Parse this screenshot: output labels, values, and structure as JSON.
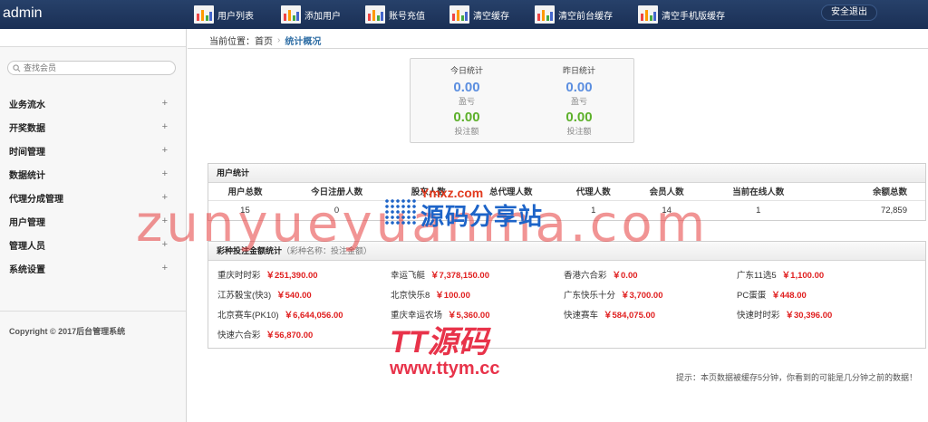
{
  "brand": "admin",
  "nav": [
    {
      "label": "用户列表",
      "icon": "chart-icon"
    },
    {
      "label": "添加用户",
      "icon": "chart-icon"
    },
    {
      "label": "账号充值",
      "icon": "chart-icon"
    },
    {
      "label": "清空缓存",
      "icon": "chart-icon"
    },
    {
      "label": "清空前台缓存",
      "icon": "chart-icon"
    },
    {
      "label": "清空手机版缓存",
      "icon": "chart-icon"
    }
  ],
  "logout_label": "安全退出",
  "sidebar": {
    "search_placeholder": "查找会员",
    "items": [
      {
        "label": "业务流水",
        "toggle": "+"
      },
      {
        "label": "开奖数据",
        "toggle": "+"
      },
      {
        "label": "时间管理",
        "toggle": "+"
      },
      {
        "label": "数据统计",
        "toggle": "+"
      },
      {
        "label": "代理分成管理",
        "toggle": "+"
      },
      {
        "label": "用户管理",
        "toggle": "+"
      },
      {
        "label": "管理人员",
        "toggle": "+"
      },
      {
        "label": "系统设置",
        "toggle": "+"
      }
    ],
    "copyright": "Copyright © 2017后台管理系统"
  },
  "breadcrumb": {
    "prefix": "当前位置：首页",
    "current": "统计概况"
  },
  "stats": {
    "today": {
      "title": "今日统计",
      "profit_value": "0.00",
      "profit_label": "盈亏",
      "bet_value": "0.00",
      "bet_label": "投注额"
    },
    "yesterday": {
      "title": "昨日统计",
      "profit_value": "0.00",
      "profit_label": "盈亏",
      "bet_value": "0.00",
      "bet_label": "投注额"
    }
  },
  "user_stats": {
    "title": "用户统计",
    "headers": [
      "用户总数",
      "今日注册人数",
      "股东人数",
      "总代理人数",
      "代理人数",
      "会员人数",
      "当前在线人数",
      "余额总数"
    ],
    "values": [
      "15",
      "0",
      "",
      "",
      "1",
      "14",
      "1",
      "72,859"
    ]
  },
  "lottery": {
    "title": "彩种投注金额统计",
    "subtitle": "（彩种名称：投注金额）",
    "items": [
      {
        "name": "重庆时时彩",
        "amount": "￥251,390.00"
      },
      {
        "name": "幸运飞艇",
        "amount": "￥7,378,150.00"
      },
      {
        "name": "香港六合彩",
        "amount": "￥0.00"
      },
      {
        "name": "广东11选5",
        "amount": "￥1,100.00"
      },
      {
        "name": "江苏骰宝(快3)",
        "amount": "￥540.00"
      },
      {
        "name": "北京快乐8",
        "amount": "￥100.00"
      },
      {
        "name": "广东快乐十分",
        "amount": "￥3,700.00"
      },
      {
        "name": "PC蛋蛋",
        "amount": "￥448.00"
      },
      {
        "name": "北京赛车(PK10)",
        "amount": "￥6,644,056.00"
      },
      {
        "name": "重庆幸运农场",
        "amount": "￥5,360.00"
      },
      {
        "name": "快速赛车",
        "amount": "￥584,075.00"
      },
      {
        "name": "快速时时彩",
        "amount": "￥30,396.00"
      },
      {
        "name": "快速六合彩",
        "amount": "￥56,870.00"
      }
    ]
  },
  "tip": "提示：本页数据被缓存5分钟，你看到的可能是几分钟之前的数据！",
  "watermarks": {
    "main": "zunyueyuanma.com",
    "logo_top": "Ymxz.com",
    "logo_big": "源码分享站",
    "tt_a": "TT源码",
    "tt_b": "www.ttym.cc"
  }
}
